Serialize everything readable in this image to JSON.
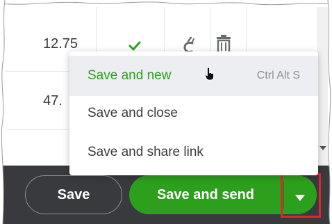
{
  "table": {
    "rows": [
      {
        "amount": "12.75"
      },
      {
        "amount": "47."
      }
    ]
  },
  "menu": {
    "items": [
      {
        "label": "Save and new",
        "shortcut": "Ctrl Alt S"
      },
      {
        "label": "Save and close"
      },
      {
        "label": "Save and share link"
      }
    ]
  },
  "footer": {
    "save_label": "Save",
    "save_send_label": "Save and send"
  },
  "colors": {
    "accent_green": "#2ca01c",
    "footer_bg": "#393a3d",
    "highlight_red": "#e0262d"
  },
  "icons": {
    "check": "check-icon",
    "tax": "tax-icon",
    "trash": "trash-icon",
    "caret": "caret-down-icon",
    "cursor": "hand-cursor-icon"
  }
}
